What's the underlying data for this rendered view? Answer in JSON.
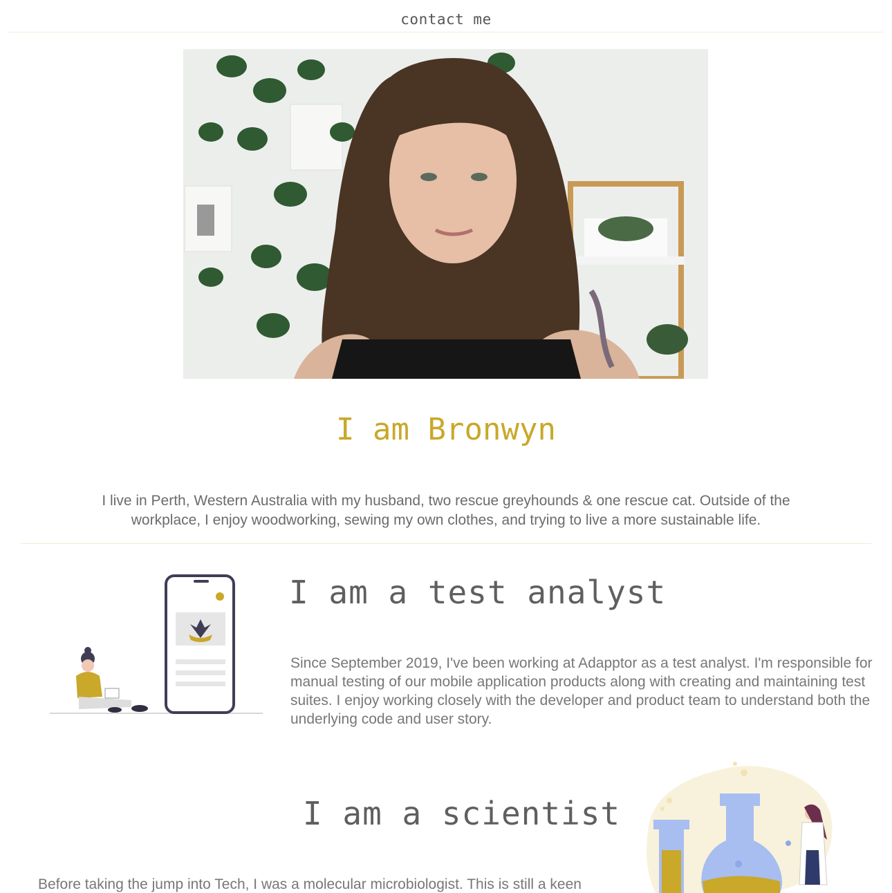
{
  "nav": {
    "contact_label": "contact me"
  },
  "hero": {
    "title": "I am Bronwyn",
    "bio": "I live in Perth, Western Australia with my husband, two rescue greyhounds & one rescue cat. Outside of the workplace, I enjoy woodworking, sewing my own clothes, and trying to live a more sustainable life."
  },
  "sections": {
    "test_analyst": {
      "title": "I am a test analyst",
      "text": "Since September 2019, I've been working at Adapptor as a test analyst. I'm responsible for manual testing of our mobile application products along with creating and maintaining test suites. I enjoy working closely with the developer and product team to understand both the underlying code and user story."
    },
    "scientist": {
      "title": "I am a scientist",
      "text": "Before taking the jump into Tech, I was a molecular microbiologist. This is still a keen"
    }
  },
  "colors": {
    "accent": "#c9a82a",
    "divider": "#f3ecd2",
    "text": "#777777",
    "heading": "#5f5f5f"
  }
}
